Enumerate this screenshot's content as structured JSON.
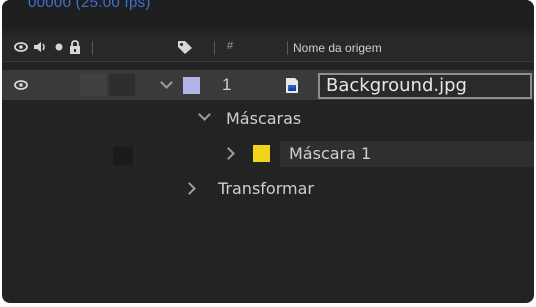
{
  "panel": {
    "timecode_partial": "00000 (25.00 fps)",
    "header": {
      "columns": {
        "hash": "#",
        "source_name": "Nome da origem"
      },
      "icons": [
        "eye-icon",
        "speaker-icon",
        "solo-dot-icon",
        "lock-icon",
        "label-tag-icon"
      ]
    },
    "layers": [
      {
        "number": "1",
        "name": "Background.jpg",
        "label_color": "#b3b3e6",
        "expanded": true,
        "visible": true
      }
    ],
    "properties": {
      "masks_group": "Máscaras",
      "mask_1": {
        "name": "Máscara 1",
        "color": "#f2d51a"
      },
      "transform_group": "Transformar"
    }
  }
}
